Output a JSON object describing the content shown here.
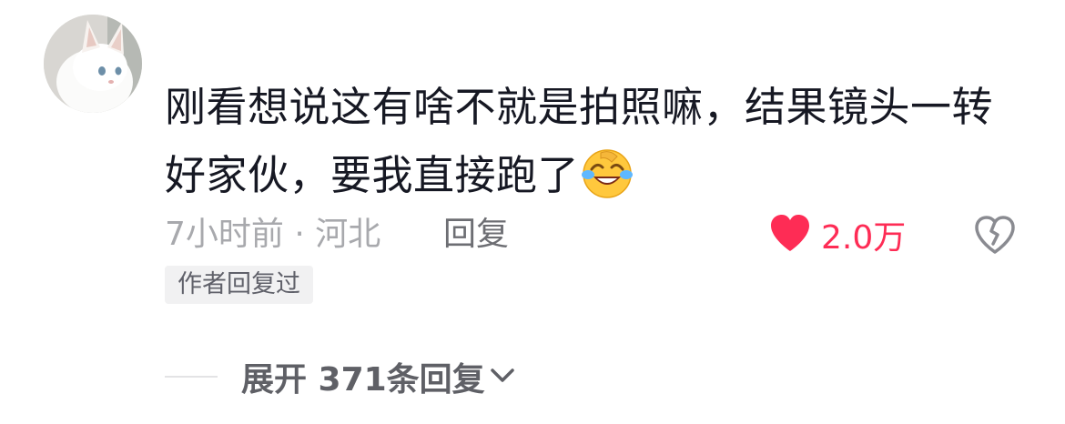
{
  "comment": {
    "text_line_1": "刚看想说这有啥不就是拍照嘛，结果镜头一转",
    "text_line_2": "好家伙，要我直接跑了",
    "emoji": "laughing-crying-emoji",
    "time_location": "7小时前 · 河北",
    "reply_label": "回复",
    "like_count": "2.0万",
    "author_badge": "作者回复过",
    "expand_label": "展开 371条回复"
  },
  "colors": {
    "text": "#161823",
    "meta": "#a8a9ad",
    "like": "#fe2c55",
    "badge_bg": "#f1f1f2"
  },
  "icons": {
    "avatar": "white-cat-avatar",
    "like": "heart-icon",
    "dislike": "broken-heart-icon",
    "expand": "chevron-down-icon"
  }
}
